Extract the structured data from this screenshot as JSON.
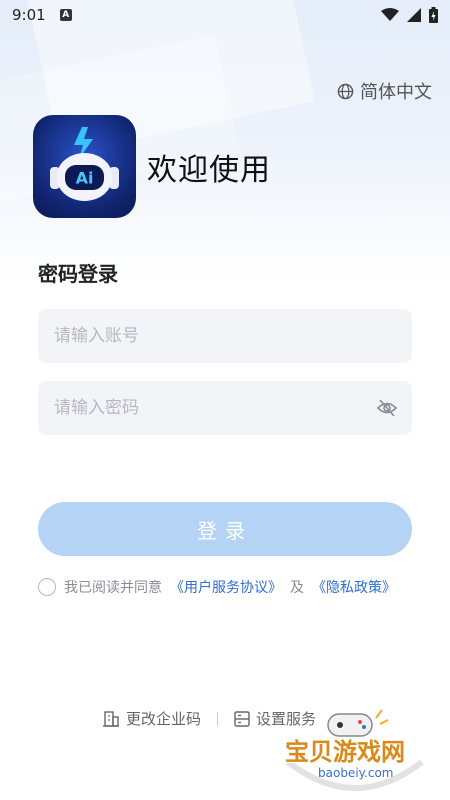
{
  "status_bar": {
    "time": "9:01",
    "badge": "A",
    "icons": [
      "wifi-icon",
      "signal-icon",
      "battery-icon"
    ]
  },
  "language": {
    "label": "简体中文",
    "icon": "globe-icon"
  },
  "header": {
    "logo_text": "Ai",
    "welcome": "欢迎使用"
  },
  "form": {
    "title": "密码登录",
    "account_placeholder": "请输入账号",
    "password_placeholder": "请输入密码",
    "login_label": "登录"
  },
  "agreement": {
    "prefix": "我已阅读并同意",
    "user_agreement": "《用户服务协议》",
    "and": "及",
    "privacy_policy": "《隐私政策》"
  },
  "bottom": {
    "change_code": "更改企业码",
    "set_service": "设置服务"
  },
  "watermark": {
    "title": "宝贝游戏网",
    "url": "baobeiy.com"
  },
  "colors": {
    "accent": "#2f6fd4",
    "login_button": "#b5d3f5",
    "input_bg": "#f3f4f8"
  }
}
